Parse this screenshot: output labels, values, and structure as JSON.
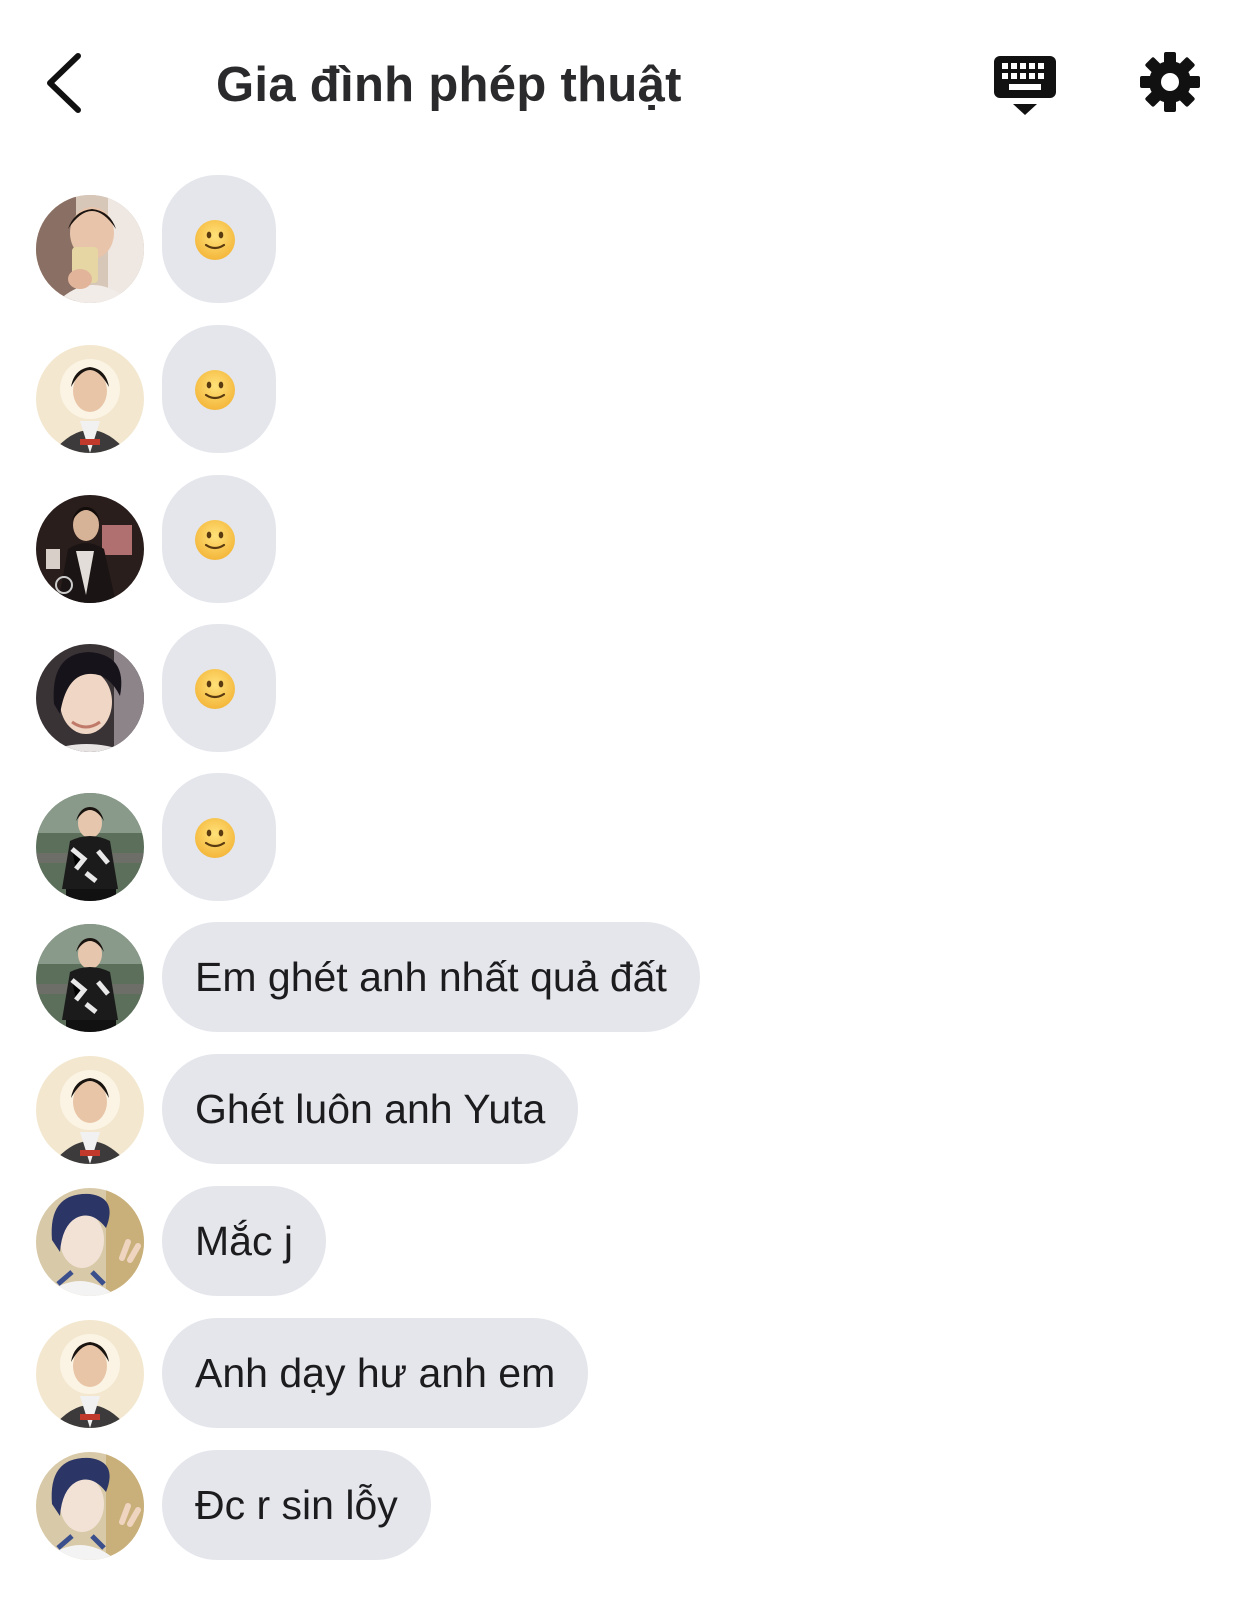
{
  "header": {
    "title": "Gia đình phép thuật",
    "back_icon": "chevron-left-icon",
    "keyboard_icon": "keyboard-icon",
    "settings_icon": "gear-icon"
  },
  "messages": [
    {
      "type": "emoji",
      "emoji": "🙂",
      "avatar": "avatar-1"
    },
    {
      "type": "emoji",
      "emoji": "🙂",
      "avatar": "avatar-2"
    },
    {
      "type": "emoji",
      "emoji": "🙂",
      "avatar": "avatar-3"
    },
    {
      "type": "emoji",
      "emoji": "🙂",
      "avatar": "avatar-4"
    },
    {
      "type": "emoji",
      "emoji": "🙂",
      "avatar": "avatar-5"
    },
    {
      "type": "text",
      "text": "Em ghét anh nhất quả đất",
      "avatar": "avatar-5"
    },
    {
      "type": "text",
      "text": "Ghét luôn anh Yuta",
      "avatar": "avatar-2"
    },
    {
      "type": "text",
      "text": "Mắc j",
      "avatar": "avatar-6"
    },
    {
      "type": "text",
      "text": "Anh dạy hư anh em",
      "avatar": "avatar-2"
    },
    {
      "type": "text",
      "text": "Đc r sin lỗy",
      "avatar": "avatar-6"
    }
  ],
  "colors": {
    "bubble": "#e4e6eb",
    "text": "#1c1c1e",
    "icon": "#111111"
  }
}
